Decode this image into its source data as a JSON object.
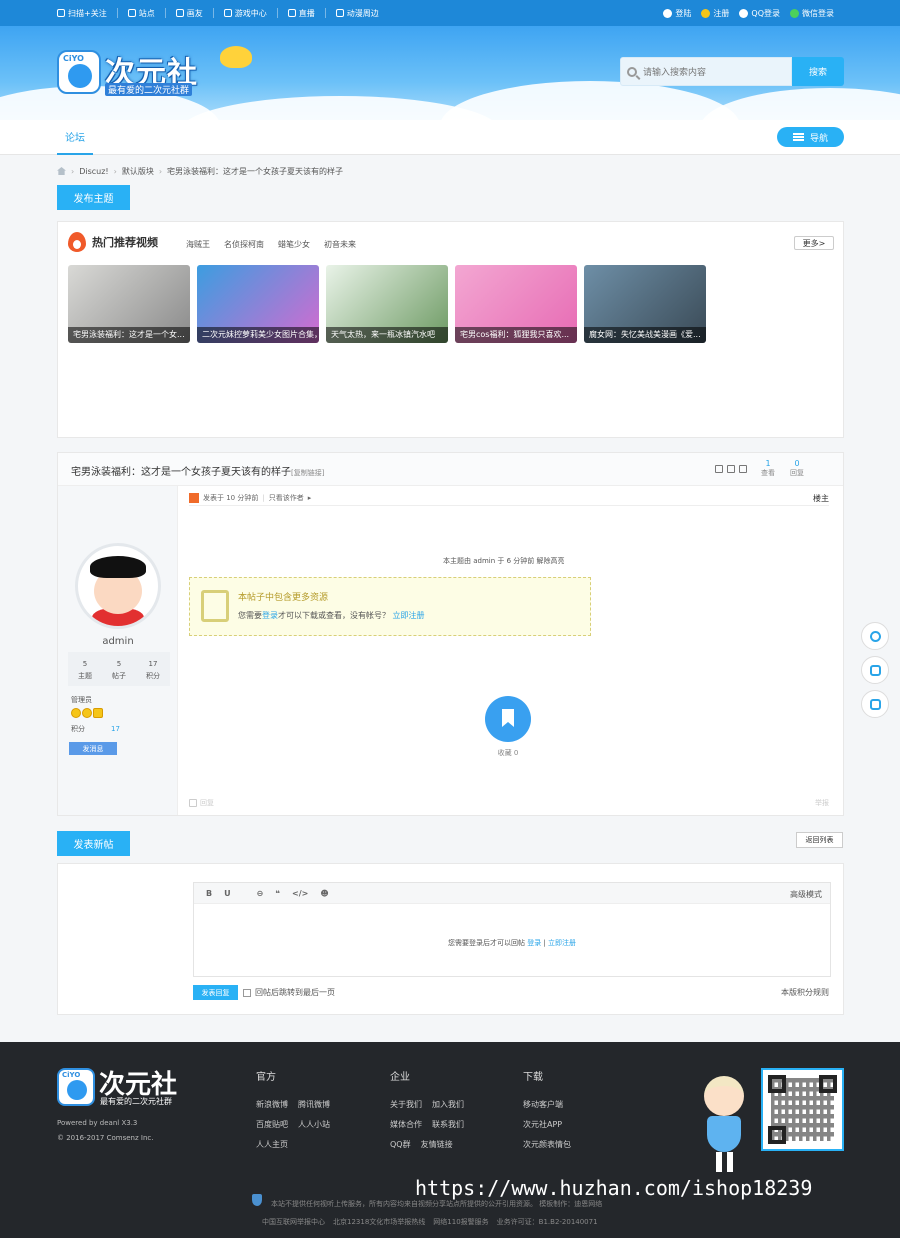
{
  "topbar": {
    "left": [
      "扫描+关注",
      "站点",
      "画友",
      "游戏中心",
      "直播",
      "动漫周边"
    ],
    "right": [
      "登陆",
      "注册",
      "QQ登录",
      "微信登录"
    ]
  },
  "brand": {
    "badge": "CiYO",
    "name": "次元社",
    "slogan": "最有爱的二次元社群"
  },
  "search": {
    "placeholder": "请输入搜索内容",
    "button": "搜索"
  },
  "nav": {
    "tab": "论坛",
    "guide": "导航"
  },
  "breadcrumb": [
    "Discuz!",
    "默认版块",
    "宅男泳装福利：这才是一个女孩子夏天该有的样子"
  ],
  "post_button": "发布主题",
  "hot": {
    "title": "热门推荐视频",
    "tags": [
      "海贼王",
      "名侦探柯南",
      "蜡笔少女",
      "初音未来"
    ],
    "more": "更多>",
    "items": [
      {
        "caption": "宅男泳装福利：这才是一个女...",
        "colors": [
          "#d9d9d6",
          "#8a8a8a"
        ]
      },
      {
        "caption": "二次元妹控萝莉美少女图片合集，...",
        "colors": [
          "#3c9de0",
          "#d46bd0"
        ]
      },
      {
        "caption": "天气太热，来一瓶冰镇汽水吧",
        "colors": [
          "#e9f3e8",
          "#6d9a63"
        ]
      },
      {
        "caption": "宅男cos福利：狐狸我只喜欢...",
        "colors": [
          "#f3a7d2",
          "#e76bb4"
        ]
      },
      {
        "caption": "腐女网：失忆美战美漫画《爱...",
        "colors": [
          "#6e8fa7",
          "#3a4a56"
        ]
      }
    ]
  },
  "thread": {
    "title": "宅男泳装福利：这才是一个女孩子夏天该有的样子",
    "copy_link": "[复制链接]",
    "views_num": "1",
    "views_label": "查看",
    "replies_num": "0",
    "replies_label": "回复"
  },
  "author": {
    "name": "admin",
    "stats": [
      {
        "num": "5",
        "label": "主题"
      },
      {
        "num": "5",
        "label": "帖子"
      },
      {
        "num": "17",
        "label": "积分"
      }
    ],
    "role": "管理员",
    "score_label": "积分",
    "score": "17",
    "message_button": "发消息"
  },
  "post": {
    "meta": "发表于 10 分钟前",
    "only_author": "只看该作者",
    "floor": "楼主",
    "notice": "本主题由 admin 于 6 分钟前 解除高亮",
    "resource_title": "本帖子中包含更多资源",
    "resource_prefix": "您需要",
    "resource_login": "登录",
    "resource_mid": "才可以下载或查看，没有帐号？",
    "resource_register": "立即注册",
    "favorite": "收藏 0",
    "reply_hint": "回复",
    "report": "举报"
  },
  "reply": {
    "title": "发表新帖",
    "back": "返回列表",
    "tools": [
      "B",
      "U",
      "⊖",
      "❝",
      "</>",
      "☻"
    ],
    "advanced": "高级模式",
    "login_prefix": "您需要登录后才可以回帖",
    "login": "登录",
    "sep": "|",
    "register": "立即注册",
    "submit": "发表回复",
    "jump": "回帖后跳转到最后一页",
    "rules": "本版积分规则"
  },
  "footer": {
    "powered": "Powered by deanl X3.3",
    "copyright": "© 2016-2017 Comsenz Inc.",
    "col1": {
      "title": "官方",
      "rows": [
        [
          "新浪微博",
          "腾讯微博"
        ],
        [
          "百度贴吧",
          "人人小站"
        ],
        [
          "人人主页"
        ]
      ]
    },
    "col2": {
      "title": "企业",
      "rows": [
        [
          "关于我们",
          "加入我们"
        ],
        [
          "媒体合作",
          "联系我们"
        ],
        [
          "QQ群",
          "友情链接"
        ]
      ]
    },
    "col3": {
      "title": "下载",
      "rows": [
        [
          "移动客户端"
        ],
        [
          "次元社APP"
        ],
        [
          "次元颜表情包"
        ]
      ]
    },
    "watermark": "https://www.huzhan.com/ishop18239",
    "disclaimer": "本站不提供任何视听上传服务，所有内容均来自视频分享站点所提供的公开引用资源。 模板制作：迪恩网络",
    "links": [
      "中国互联网举报中心",
      "北京12318文化市场举报热线",
      "网络110报警服务",
      "业务许可证：B1.B2-20140071"
    ]
  },
  "colors": {
    "accent": "#29b1f5",
    "topbar": "#1e88d8",
    "footer": "#24272b"
  }
}
